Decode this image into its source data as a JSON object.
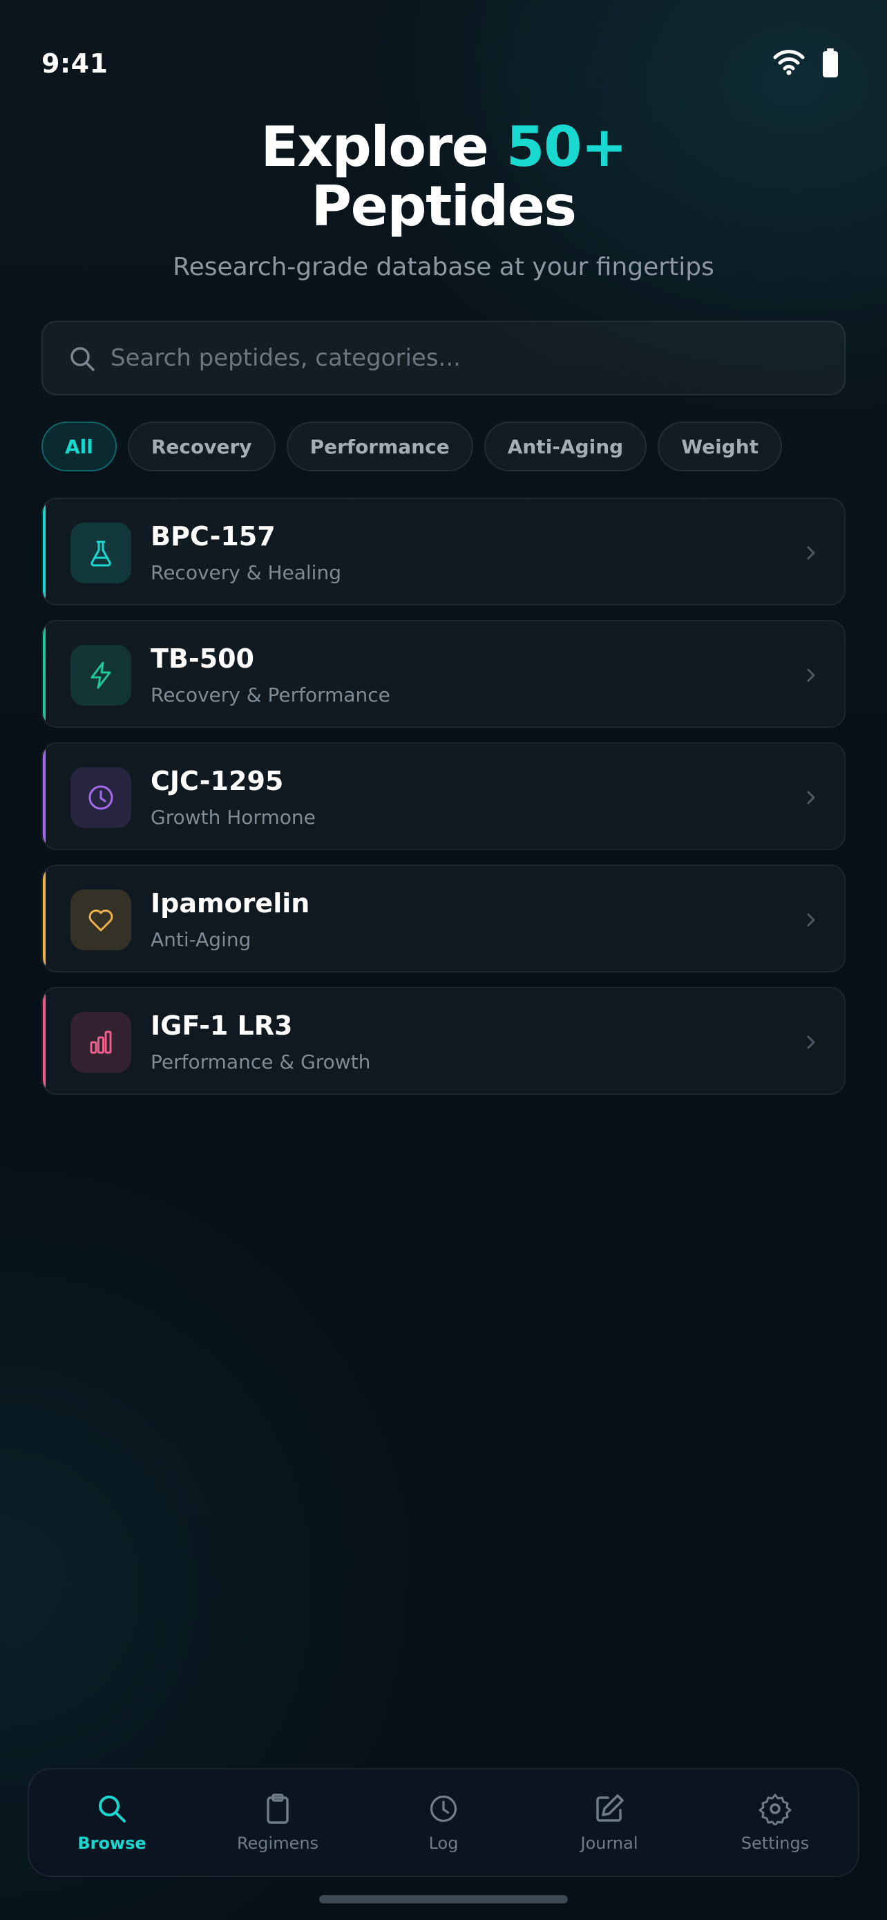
{
  "status_bar": {
    "time": "9:41"
  },
  "hero": {
    "title_prefix": "Explore ",
    "title_accent": "50+",
    "title_suffix": "Peptides",
    "subtitle": "Research-grade database at your fingertips"
  },
  "search": {
    "placeholder": "Search peptides, categories..."
  },
  "filters": {
    "chips": [
      "All",
      "Recovery",
      "Performance",
      "Anti-Aging",
      "Weight"
    ],
    "selected": "All"
  },
  "peptides": [
    {
      "name": "BPC-157",
      "category": "Recovery & Healing",
      "icon": "flask-icon",
      "color": "#18d8d0"
    },
    {
      "name": "TB-500",
      "category": "Recovery & Performance",
      "icon": "lightning-icon",
      "color": "#1fc89a"
    },
    {
      "name": "CJC-1295",
      "category": "Growth Hormone",
      "icon": "clock-icon",
      "color": "#a56cf0"
    },
    {
      "name": "Ipamorelin",
      "category": "Anti-Aging",
      "icon": "heart-icon",
      "color": "#f1b24a"
    },
    {
      "name": "IGF-1 LR3",
      "category": "Performance & Growth",
      "icon": "bar-chart-icon",
      "color": "#ef5f8e"
    }
  ],
  "nav": {
    "items": [
      {
        "label": "Browse",
        "icon": "search-icon",
        "active": true
      },
      {
        "label": "Regimens",
        "icon": "clipboard-icon",
        "active": false
      },
      {
        "label": "Log",
        "icon": "clock-icon",
        "active": false
      },
      {
        "label": "Journal",
        "icon": "edit-icon",
        "active": false
      },
      {
        "label": "Settings",
        "icon": "gear-icon",
        "active": false
      }
    ]
  },
  "colors": {
    "accent": "#18d8d0",
    "background": "#081118"
  }
}
